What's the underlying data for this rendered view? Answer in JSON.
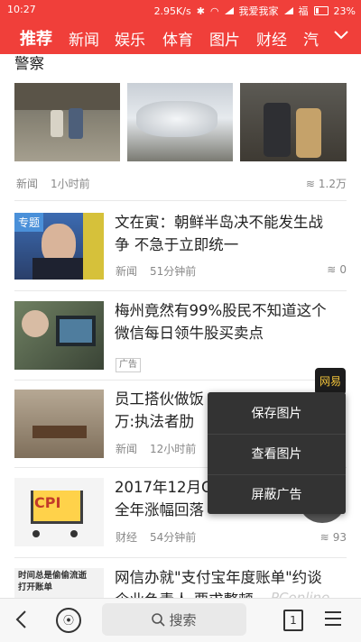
{
  "status": {
    "time": "10:27",
    "net_speed": "2.95K/s",
    "carrier1": "我爱我家",
    "carrier2": "福",
    "battery": "23%"
  },
  "channels": [
    "推荐",
    "新闻",
    "娱乐",
    "体育",
    "图片",
    "财经",
    "汽"
  ],
  "articles": [
    {
      "partial_title": "警察",
      "source": "新闻",
      "time": "1小时前",
      "comments": "1.2万"
    },
    {
      "badge": "专题",
      "title_line1": "文在寅：朝鲜半岛决不能发生战",
      "title_line2": "争 不急于立即统一",
      "source": "新闻",
      "time": "51分钟前",
      "comments": "0"
    },
    {
      "title_line1": "梅州竟然有99%股民不知道这个",
      "title_line2": "微信每日领牛股买卖点",
      "ad_label": "广告"
    },
    {
      "title_line1": "员工搭伙做饭",
      "title_line2": "万:执法者肋",
      "source": "新闻",
      "time": "12小时前",
      "ad_badge": "网易"
    },
    {
      "title_line1": "2017年12月C",
      "title_line2": "全年涨幅回落",
      "source": "财经",
      "time": "54分钟前",
      "comments": "93",
      "thumb_text": "CPI"
    },
    {
      "title_line1": "网信办就\"支付宝年度账单\"约谈",
      "title_line2": "企业负责人 要求整顿",
      "thumb_text_1": "时间总是偷偷流逝",
      "thumb_text_2": "打开账单"
    }
  ],
  "context_menu": [
    "保存图片",
    "查看图片",
    "屏蔽广告"
  ],
  "bottom_bar": {
    "search_label": "搜索",
    "tab_count": "1"
  },
  "watermark": "PConline"
}
